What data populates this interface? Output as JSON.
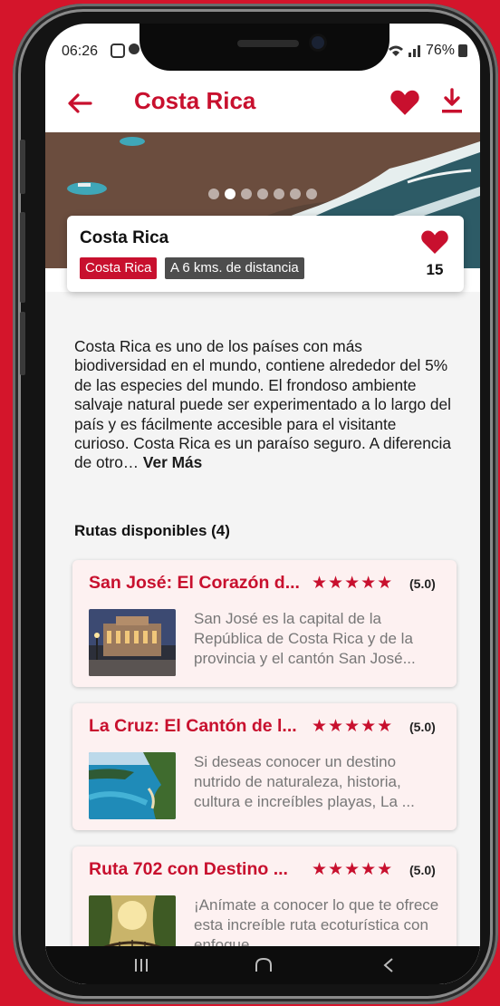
{
  "status": {
    "time": "06:26",
    "battery": "76%"
  },
  "header": {
    "title": "Costa Rica"
  },
  "carousel": {
    "count": 7,
    "active_index": 1
  },
  "place": {
    "name": "Costa Rica",
    "tag_country": "Costa Rica",
    "tag_distance": "A 6 kms. de distancia",
    "likes": "15"
  },
  "description": {
    "text": "Costa Rica es uno de los países con más biodiversidad en el mundo, contiene alrededor del 5% de las especies del mundo. El frondoso ambiente salvaje natural puede ser experimentado a lo largo del país y es fácilmente accesible para el visitante curioso. Costa Rica es un paraíso seguro. A diferencia de otro…",
    "more": "Ver Más"
  },
  "routes": {
    "title": "Rutas disponibles (4)",
    "items": [
      {
        "title": "San José: El Corazón d...",
        "stars": "★★★★★",
        "rating": "(5.0)",
        "description": "San José es la capital de la República de Costa Rica y de la provincia y el cantón San José...",
        "thumb": "city-building"
      },
      {
        "title": "La Cruz: El Cantón de l...",
        "stars": "★★★★★",
        "rating": "(5.0)",
        "description": "Si deseas conocer un destino nutrido de naturaleza, historia, cultura e increíbles playas, La ...",
        "thumb": "coastal-bay"
      },
      {
        "title": "Ruta 702 con Destino ...",
        "stars": "★★★★★",
        "rating": "(5.0)",
        "description": "¡Anímate a conocer lo que te ofrece esta increíble ruta ecoturística con enfoque ...",
        "thumb": "jungle-bridge"
      }
    ]
  },
  "colors": {
    "accent": "#c8102e",
    "background": "#d4152b",
    "tag_dark": "#4d4d4d"
  }
}
